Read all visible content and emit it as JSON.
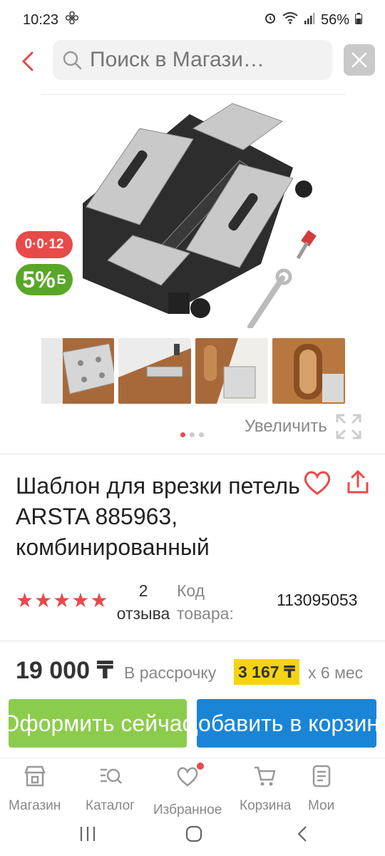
{
  "status": {
    "time": "10:23",
    "battery": "56%"
  },
  "search": {
    "placeholder": "Поиск в Магази…"
  },
  "badges": {
    "installment": "0·0·12",
    "cashback_percent": "5%",
    "cashback_currency": "Б"
  },
  "gallery": {
    "zoom_label": "Увеличить",
    "dots": 3,
    "active_dot": 0
  },
  "product": {
    "title": "Шаблон для врезки петель ARSTA 885963, комбинированный",
    "rating": 5,
    "reviews_count": "2",
    "reviews_label": "отзыва",
    "code_label": "Код товара:",
    "code_value": "113095053"
  },
  "pricing": {
    "price": "19 000 ₸",
    "installment_label": "В рассрочку",
    "installment_value": "3 167 ₸",
    "installment_term": "x 6 мес"
  },
  "actions": {
    "order_now": "Оформить сейчас",
    "add_to_cart": "Добавить в корзину"
  },
  "nav": {
    "items": [
      {
        "label": "Магазин"
      },
      {
        "label": "Каталог"
      },
      {
        "label": "Избранное"
      },
      {
        "label": "Корзина"
      },
      {
        "label": "Мои"
      }
    ]
  },
  "colors": {
    "accent_red": "#e84a4a",
    "green": "#8ccc4d",
    "blue": "#1a85d6",
    "yellow": "#f6d312"
  }
}
